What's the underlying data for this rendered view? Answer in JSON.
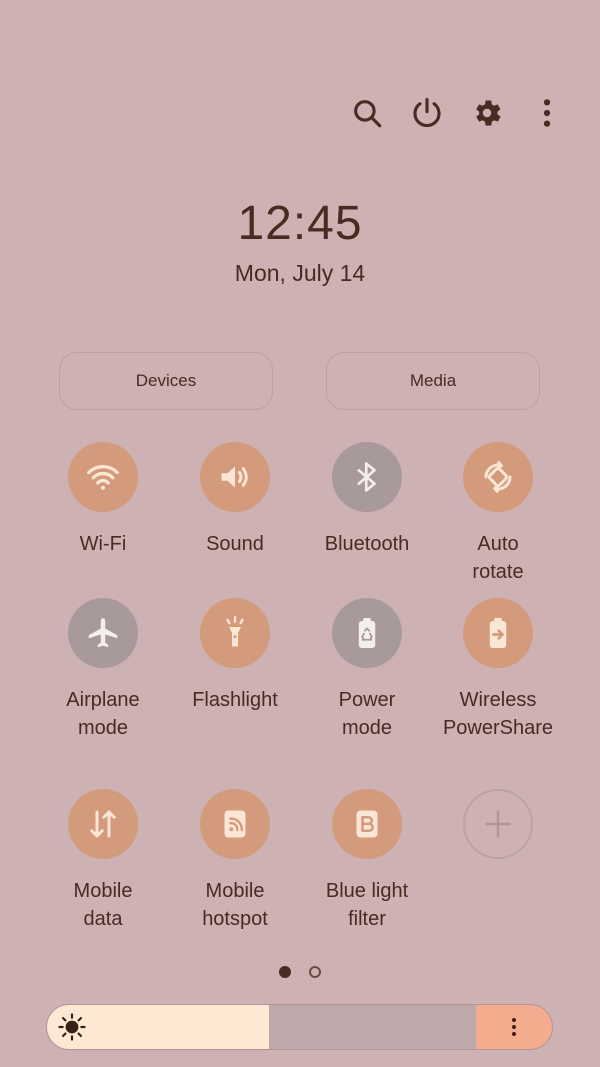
{
  "top_actions": [
    {
      "icon": "search-icon"
    },
    {
      "icon": "power-icon"
    },
    {
      "icon": "gear-icon"
    },
    {
      "icon": "more-vertical-icon"
    }
  ],
  "clock": {
    "time": "12:45",
    "date": "Mon, July 14"
  },
  "pills": {
    "devices": "Devices",
    "media": "Media"
  },
  "tiles": [
    {
      "label": "Wi-Fi",
      "icon": "wifi-icon",
      "state": "on"
    },
    {
      "label": "Sound",
      "icon": "speaker-icon",
      "state": "on"
    },
    {
      "label": "Bluetooth",
      "icon": "bluetooth-icon",
      "state": "off"
    },
    {
      "label": "Auto\nrotate",
      "icon": "auto-rotate-icon",
      "state": "on"
    },
    {
      "label": "Airplane\nmode",
      "icon": "airplane-icon",
      "state": "off"
    },
    {
      "label": "Flashlight",
      "icon": "flashlight-icon",
      "state": "on"
    },
    {
      "label": "Power\nmode",
      "icon": "battery-recycle-icon",
      "state": "off"
    },
    {
      "label": "Wireless\nPowerShare",
      "icon": "powershare-icon",
      "state": "on"
    },
    {
      "label": "Mobile\ndata",
      "icon": "data-arrows-icon",
      "state": "on"
    },
    {
      "label": "Mobile\nhotspot",
      "icon": "hotspot-icon",
      "state": "on"
    },
    {
      "label": "Blue light\nfilter",
      "icon": "blue-light-filter-icon",
      "state": "on"
    },
    {
      "label": "",
      "icon": "add-icon",
      "state": "add"
    }
  ],
  "pagination": {
    "current": 1,
    "total": 2
  },
  "brightness": {
    "level": 0.44,
    "icon": "sun-icon"
  },
  "colors": {
    "background": "#cdb1b3",
    "tile_on": "#d39a7c",
    "tile_off": "#a8999a",
    "text": "#4a2b22",
    "brightness_fill": "#fde9d3",
    "brightness_accent": "#f5ac8e"
  }
}
